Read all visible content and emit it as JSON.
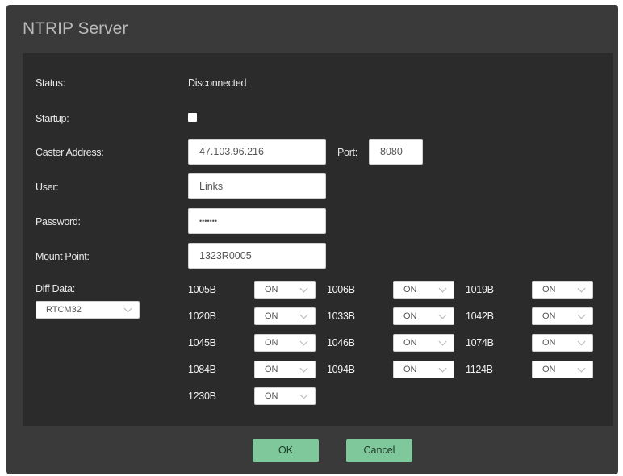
{
  "dialog": {
    "title": "NTRIP Server"
  },
  "form": {
    "status_label": "Status:",
    "status_value": "Disconnected",
    "startup_label": "Startup:",
    "startup_checked": false,
    "caster_label": "Caster Address:",
    "caster_value": "47.103.96.216",
    "port_label": "Port:",
    "port_value": "8080",
    "user_label": "User:",
    "user_value": "Links",
    "password_label": "Password:",
    "password_value": "•••••••",
    "mount_label": "Mount Point:",
    "mount_value": "1323R0005",
    "diff_label": "Diff Data:",
    "diff_value": "RTCM32"
  },
  "messages": [
    {
      "name": "1005B",
      "value": "ON"
    },
    {
      "name": "1006B",
      "value": "ON"
    },
    {
      "name": "1019B",
      "value": "ON"
    },
    {
      "name": "1020B",
      "value": "ON"
    },
    {
      "name": "1033B",
      "value": "ON"
    },
    {
      "name": "1042B",
      "value": "ON"
    },
    {
      "name": "1045B",
      "value": "ON"
    },
    {
      "name": "1046B",
      "value": "ON"
    },
    {
      "name": "1074B",
      "value": "ON"
    },
    {
      "name": "1084B",
      "value": "ON"
    },
    {
      "name": "1094B",
      "value": "ON"
    },
    {
      "name": "1124B",
      "value": "ON"
    },
    {
      "name": "1230B",
      "value": "ON"
    }
  ],
  "buttons": {
    "ok": "OK",
    "cancel": "Cancel"
  },
  "colors": {
    "dialog_bg": "#3a3a3a",
    "panel_bg": "#2b2b2b",
    "button_green": "#7ec89c"
  }
}
